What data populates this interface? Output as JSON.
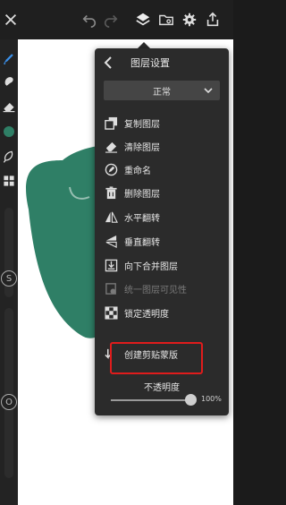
{
  "topbar": {
    "icons": [
      "close-icon",
      "undo-icon",
      "redo-icon",
      "layers-icon",
      "folder-icon",
      "gear-icon",
      "share-icon"
    ]
  },
  "left_toolbar": {
    "icons": [
      "brush-icon",
      "smudge-icon",
      "eraser-icon",
      "color-swatch",
      "lasso-icon",
      "gallery-icon"
    ],
    "size_label": "S",
    "opacity_label": "O",
    "accent": "#2f7f66"
  },
  "panel": {
    "title": "图层设置",
    "blend_mode": "正常",
    "items": [
      {
        "label": "复制图层",
        "icon": "duplicate-icon"
      },
      {
        "label": "清除图层",
        "icon": "eraser-icon"
      },
      {
        "label": "重命名",
        "icon": "rename-icon"
      },
      {
        "label": "删除图层",
        "icon": "trash-icon"
      },
      {
        "label": "水平翻转",
        "icon": "flip-horizontal-icon"
      },
      {
        "label": "垂直翻转",
        "icon": "flip-vertical-icon"
      },
      {
        "label": "向下合并图层",
        "icon": "merge-down-icon"
      },
      {
        "label": "统一图层可见性",
        "icon": "visibility-icon",
        "disabled": true
      },
      {
        "label": "锁定透明度",
        "icon": "checker-icon"
      },
      {
        "label": "创建剪贴蒙版",
        "icon": "clipping-mask-icon"
      }
    ],
    "opacity_label": "不透明度",
    "opacity_value": "100%",
    "opacity_fraction": 1.0
  },
  "canvas": {
    "shape_color": "#2f7f66",
    "background": "#ffffff"
  },
  "colors": {
    "highlight_box": "#e01c1c",
    "panel_bg": "#2b2b2b"
  }
}
